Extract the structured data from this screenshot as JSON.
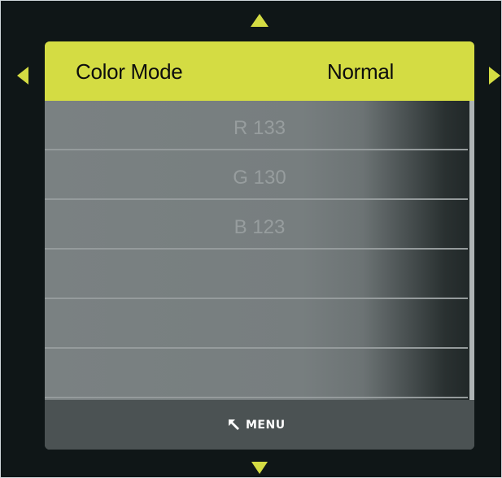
{
  "menu": {
    "selected": {
      "label": "Color Mode",
      "value": "Normal"
    },
    "items": [
      {
        "label": "R 133"
      },
      {
        "label": "G 130"
      },
      {
        "label": "B 123"
      },
      {
        "label": ""
      },
      {
        "label": ""
      },
      {
        "label": ""
      }
    ],
    "footer": {
      "menu_label": "MENU",
      "menu_icon": "return-arrow-icon"
    }
  },
  "navigation": {
    "up_icon": "arrow-up-icon",
    "down_icon": "arrow-down-icon",
    "left_icon": "arrow-left-icon",
    "right_icon": "arrow-right-icon"
  },
  "colors": {
    "background": "#0f1617",
    "highlight": "#d4dc43",
    "arrow": "#d4dc43",
    "list": "#777e7f",
    "footer": "#4b5253",
    "item_text": "#979d9e"
  }
}
